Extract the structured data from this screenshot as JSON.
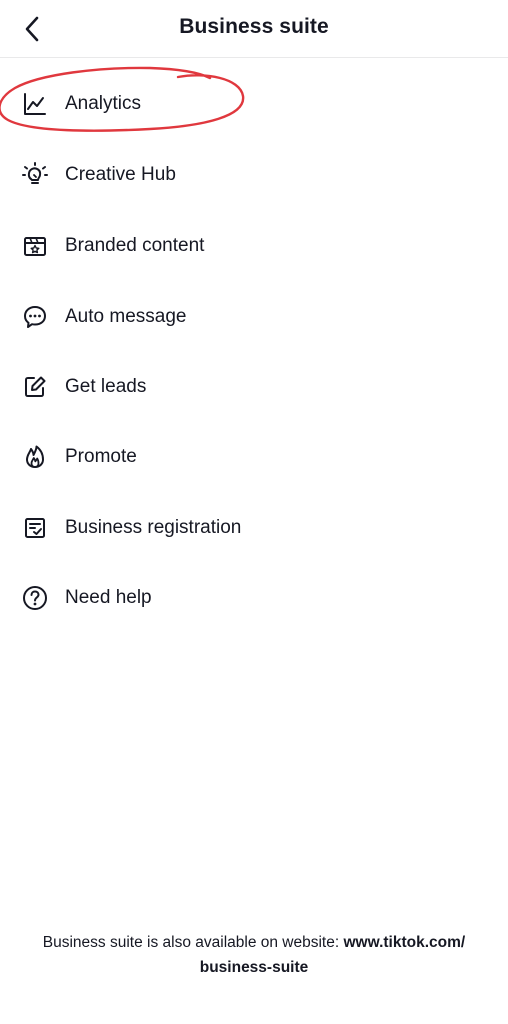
{
  "header": {
    "title": "Business suite",
    "back_icon": "chevron-left-icon"
  },
  "menu": {
    "items": [
      {
        "label": "Analytics",
        "icon": "chart-line-icon"
      },
      {
        "label": "Creative Hub",
        "icon": "lightbulb-icon"
      },
      {
        "label": "Branded content",
        "icon": "branded-content-icon"
      },
      {
        "label": "Auto message",
        "icon": "chat-bubble-icon"
      },
      {
        "label": "Get leads",
        "icon": "edit-icon"
      },
      {
        "label": "Promote",
        "icon": "flame-icon"
      },
      {
        "label": "Business registration",
        "icon": "registration-icon"
      },
      {
        "label": "Need help",
        "icon": "question-circle-icon"
      }
    ]
  },
  "footer": {
    "text": "Business suite is also available on website:",
    "link_line1": "www.tiktok.com/",
    "link_line2": "business-suite"
  },
  "colors": {
    "text": "#161823",
    "annotation": "#e0383e",
    "divider": "#e9e9ea"
  }
}
